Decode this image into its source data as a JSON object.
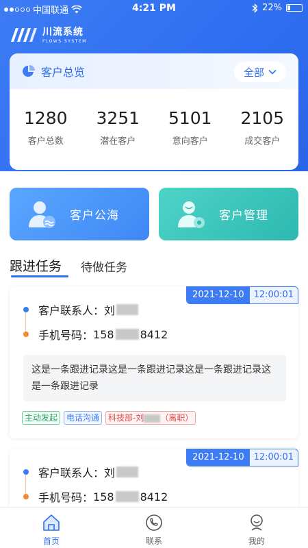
{
  "colors": {
    "primary": "#2f6ef0",
    "teal": "#2cb9b0",
    "orange": "#f08a2a"
  },
  "status_bar": {
    "carrier": "中国联通",
    "time": "4:21 PM",
    "battery": "22%",
    "battery_level": 0.22
  },
  "logo": {
    "cn": "川流系统",
    "en": "FLOWS SYSTEM"
  },
  "overview": {
    "title": "客户总览",
    "filter_label": "全部",
    "stats": [
      {
        "value": "1280",
        "label": "客户总数"
      },
      {
        "value": "3251",
        "label": "潜在客户"
      },
      {
        "value": "5101",
        "label": "意向客户"
      },
      {
        "value": "2105",
        "label": "成交客户"
      }
    ]
  },
  "actions": {
    "pool": "客户公海",
    "manage": "客户管理"
  },
  "tabs": {
    "follow": "跟进任务",
    "todo": "待做任务"
  },
  "tasks": [
    {
      "date": "2021-12-10",
      "time": "12:00:01",
      "contact_label": "客户联系人：",
      "contact_name": "刘",
      "phone_label": "手机号码：",
      "phone_prefix": "158",
      "phone_suffix": "8412",
      "note": "这是一条跟进记录这是一条跟进记录这是一条跟进记录这是一条跟进记录",
      "tags": {
        "initiate": "主动发起",
        "method": "电话沟通",
        "dept_prefix": "科技部-刘",
        "dept_suffix": "（离职）"
      }
    },
    {
      "date": "2021-12-10",
      "time": "12:00:01",
      "contact_label": "客户联系人：",
      "contact_name": "刘",
      "phone_label": "手机号码：",
      "phone_prefix": "158",
      "phone_suffix": "8412"
    }
  ],
  "tabbar": {
    "home": "首页",
    "contact": "联系",
    "mine": "我的"
  }
}
